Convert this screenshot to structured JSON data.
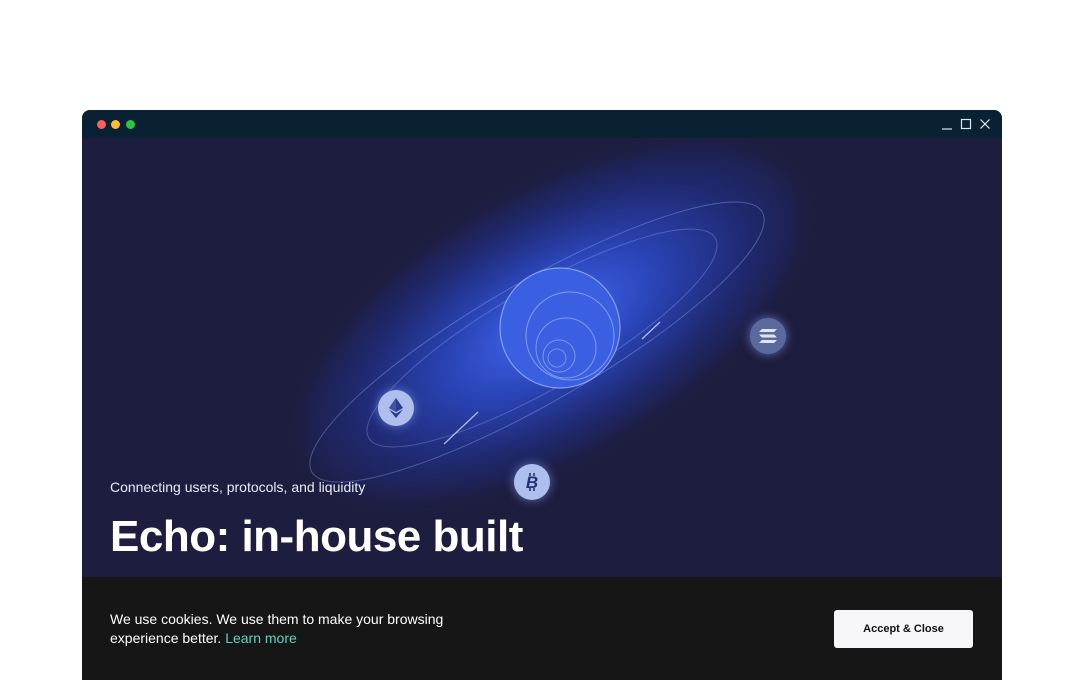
{
  "window": {
    "controls": [
      "close-dot",
      "minimize-dot",
      "zoom-dot"
    ],
    "titlebar_color": "#0a2033"
  },
  "hero": {
    "tagline": "Connecting users, protocols, and liquidity",
    "headline": "Echo: in-house built",
    "background_color": "#1d1d3f",
    "coins": [
      "ethereum-icon",
      "bitcoin-icon",
      "solana-icon"
    ]
  },
  "cookie_banner": {
    "text": "We use cookies. We use them to make your browsing experience better.",
    "link_label": "Learn more",
    "accept_label": "Accept & Close",
    "link_color": "#5fd3c0"
  }
}
